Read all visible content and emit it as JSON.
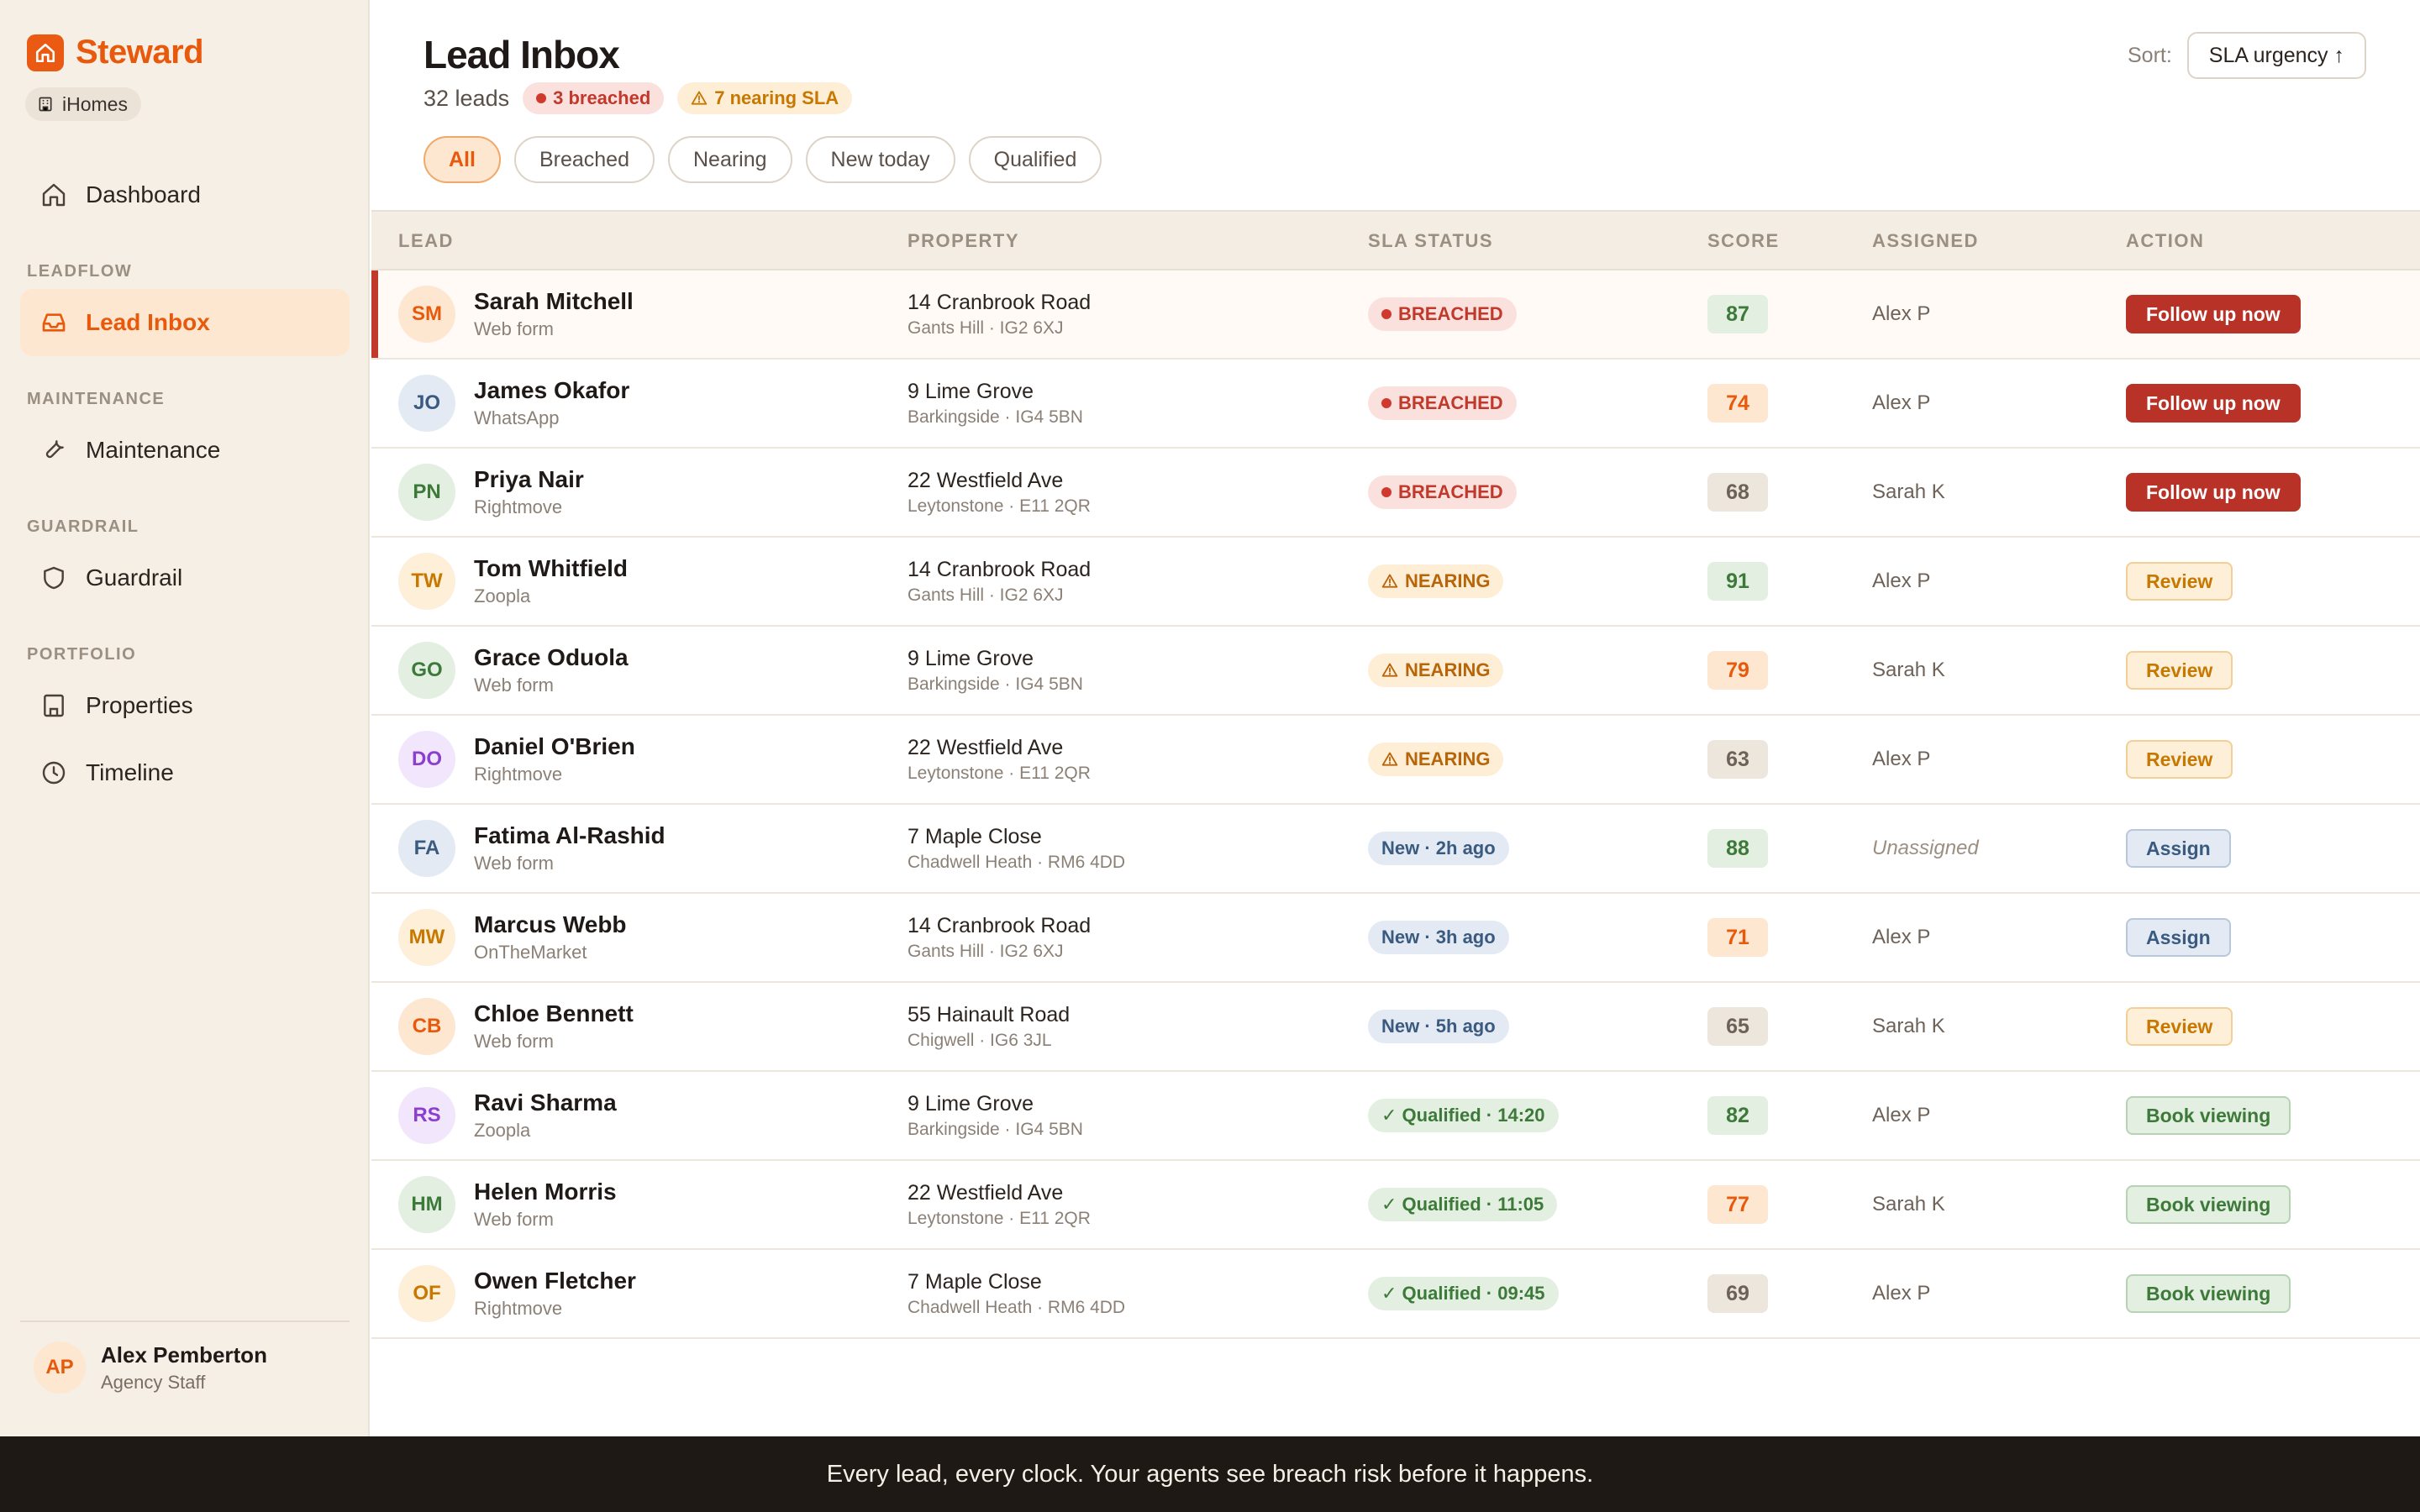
{
  "brand": {
    "name": "Steward",
    "org": "iHomes"
  },
  "sidebar": {
    "dashboard": "Dashboard",
    "sections": [
      "LEADFLOW",
      "MAINTENANCE",
      "GUARDRAIL",
      "PORTFOLIO"
    ],
    "lead_inbox": "Lead Inbox",
    "maintenance": "Maintenance",
    "guardrail": "Guardrail",
    "properties": "Properties",
    "timeline": "Timeline"
  },
  "user": {
    "initials": "AP",
    "name": "Alex Pemberton",
    "role": "Agency Staff"
  },
  "header": {
    "title": "Lead Inbox",
    "count": "32 leads",
    "breached_badge": "3 breached",
    "nearing_badge": "7 nearing SLA",
    "sort_label": "Sort:",
    "sort_value": "SLA urgency ↑"
  },
  "filters": [
    "All",
    "Breached",
    "Nearing",
    "New today",
    "Qualified"
  ],
  "columns": [
    "LEAD",
    "PROPERTY",
    "SLA STATUS",
    "SCORE",
    "ASSIGNED",
    "ACTION"
  ],
  "rows": [
    {
      "initials": "SM",
      "name": "Sarah Mitchell",
      "source": "Web form",
      "address": "14 Cranbrook Road",
      "area": "Gants Hill · IG2 6XJ",
      "sla": "BREACHED",
      "sla_kind": "breached",
      "score": "87",
      "score_kind": "green",
      "assigned": "Alex P",
      "action": "Follow up now",
      "action_kind": "followup",
      "avatar_bg": "#fde7d1",
      "avatar_fg": "#e8590c"
    },
    {
      "initials": "JO",
      "name": "James Okafor",
      "source": "WhatsApp",
      "address": "9 Lime Grove",
      "area": "Barkingside · IG4 5BN",
      "sla": "BREACHED",
      "sla_kind": "breached",
      "score": "74",
      "score_kind": "orange",
      "assigned": "Alex P",
      "action": "Follow up now",
      "action_kind": "followup",
      "avatar_bg": "#e3eaf3",
      "avatar_fg": "#3a5a80"
    },
    {
      "initials": "PN",
      "name": "Priya Nair",
      "source": "Rightmove",
      "address": "22 Westfield Ave",
      "area": "Leytonstone · E11 2QR",
      "sla": "BREACHED",
      "sla_kind": "breached",
      "score": "68",
      "score_kind": "gray",
      "assigned": "Sarah K",
      "action": "Follow up now",
      "action_kind": "followup",
      "avatar_bg": "#e2efe1",
      "avatar_fg": "#3d7a3a"
    },
    {
      "initials": "TW",
      "name": "Tom Whitfield",
      "source": "Zoopla",
      "address": "14 Cranbrook Road",
      "area": "Gants Hill · IG2 6XJ",
      "sla": "NEARING",
      "sla_kind": "nearing",
      "score": "91",
      "score_kind": "green",
      "assigned": "Alex P",
      "action": "Review",
      "action_kind": "review",
      "avatar_bg": "#fdefd8",
      "avatar_fg": "#c77800"
    },
    {
      "initials": "GO",
      "name": "Grace Oduola",
      "source": "Web form",
      "address": "9 Lime Grove",
      "area": "Barkingside · IG4 5BN",
      "sla": "NEARING",
      "sla_kind": "nearing",
      "score": "79",
      "score_kind": "orange",
      "assigned": "Sarah K",
      "action": "Review",
      "action_kind": "review",
      "avatar_bg": "#e2efe1",
      "avatar_fg": "#3d7a3a"
    },
    {
      "initials": "DO",
      "name": "Daniel O'Brien",
      "source": "Rightmove",
      "address": "22 Westfield Ave",
      "area": "Leytonstone · E11 2QR",
      "sla": "NEARING",
      "sla_kind": "nearing",
      "score": "63",
      "score_kind": "gray",
      "assigned": "Alex P",
      "action": "Review",
      "action_kind": "review",
      "avatar_bg": "#f1e6fb",
      "avatar_fg": "#8a3fd1"
    },
    {
      "initials": "FA",
      "name": "Fatima Al-Rashid",
      "source": "Web form",
      "address": "7 Maple Close",
      "area": "Chadwell Heath · RM6 4DD",
      "sla": "New · 2h ago",
      "sla_kind": "new",
      "score": "88",
      "score_kind": "green",
      "assigned": "Unassigned",
      "assigned_kind": "unassigned",
      "action": "Assign",
      "action_kind": "assign",
      "avatar_bg": "#e3eaf3",
      "avatar_fg": "#3a5a80"
    },
    {
      "initials": "MW",
      "name": "Marcus Webb",
      "source": "OnTheMarket",
      "address": "14 Cranbrook Road",
      "area": "Gants Hill · IG2 6XJ",
      "sla": "New · 3h ago",
      "sla_kind": "new",
      "score": "71",
      "score_kind": "orange",
      "assigned": "Alex P",
      "action": "Assign",
      "action_kind": "assign",
      "avatar_bg": "#fdefd8",
      "avatar_fg": "#c77800"
    },
    {
      "initials": "CB",
      "name": "Chloe Bennett",
      "source": "Web form",
      "address": "55 Hainault Road",
      "area": "Chigwell · IG6 3JL",
      "sla": "New · 5h ago",
      "sla_kind": "new",
      "score": "65",
      "score_kind": "gray",
      "assigned": "Sarah K",
      "action": "Review",
      "action_kind": "review",
      "avatar_bg": "#fde7d1",
      "avatar_fg": "#e8590c"
    },
    {
      "initials": "RS",
      "name": "Ravi Sharma",
      "source": "Zoopla",
      "address": "9 Lime Grove",
      "area": "Barkingside · IG4 5BN",
      "sla": "✓ Qualified · 14:20",
      "sla_kind": "qualified",
      "score": "82",
      "score_kind": "green",
      "assigned": "Alex P",
      "action": "Book viewing",
      "action_kind": "book",
      "avatar_bg": "#f1e6fb",
      "avatar_fg": "#8a3fd1"
    },
    {
      "initials": "HM",
      "name": "Helen Morris",
      "source": "Web form",
      "address": "22 Westfield Ave",
      "area": "Leytonstone · E11 2QR",
      "sla": "✓ Qualified · 11:05",
      "sla_kind": "qualified",
      "score": "77",
      "score_kind": "orange",
      "assigned": "Sarah K",
      "action": "Book viewing",
      "action_kind": "book",
      "avatar_bg": "#e2efe1",
      "avatar_fg": "#3d7a3a"
    },
    {
      "initials": "OF",
      "name": "Owen Fletcher",
      "source": "Rightmove",
      "address": "7 Maple Close",
      "area": "Chadwell Heath · RM6 4DD",
      "sla": "✓ Qualified · 09:45",
      "sla_kind": "qualified",
      "score": "69",
      "score_kind": "gray",
      "assigned": "Alex P",
      "action": "Book viewing",
      "action_kind": "book",
      "avatar_bg": "#fdefd8",
      "avatar_fg": "#c77800"
    }
  ],
  "footer": {
    "tagline": "Every lead, every clock. Your agents see breach risk before it happens."
  }
}
